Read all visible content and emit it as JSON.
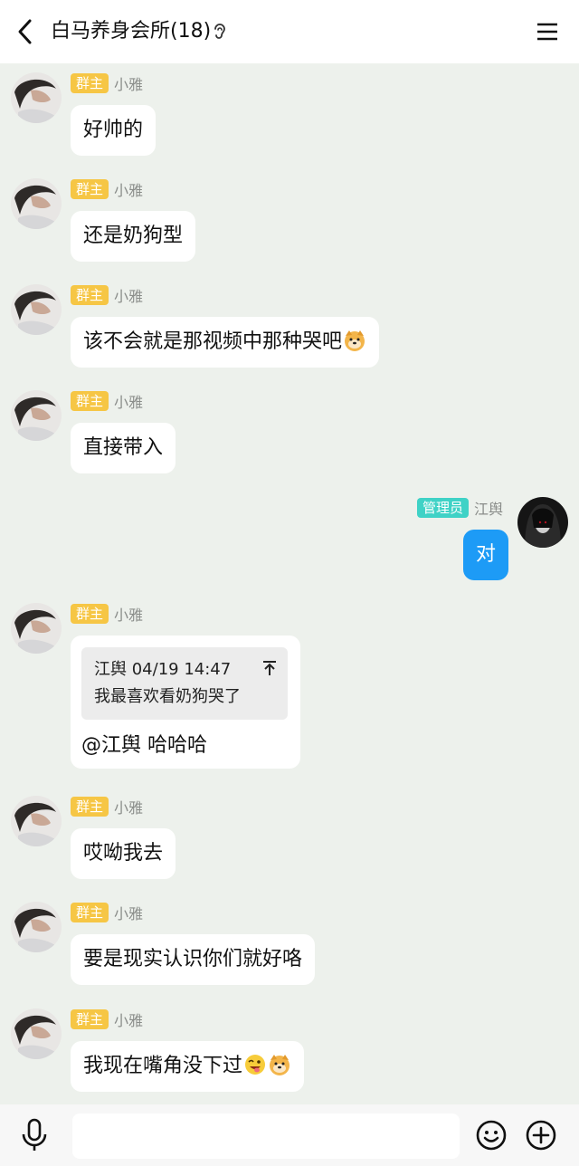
{
  "header": {
    "title": "白马养身会所(18)"
  },
  "messages": [
    {
      "role": "群主",
      "name": "小雅",
      "text": "好帅的"
    },
    {
      "role": "群主",
      "name": "小雅",
      "text": "还是奶狗型"
    },
    {
      "role": "群主",
      "name": "小雅",
      "text": "该不会就是那视频中那种哭吧"
    },
    {
      "role": "群主",
      "name": "小雅",
      "text": "直接带入"
    },
    {
      "role": "管理员",
      "name": "江舆",
      "text": "对"
    },
    {
      "role": "群主",
      "name": "小雅",
      "quote_header": "江舆 04/19 14:47",
      "quote_text": "我最喜欢看奶狗哭了",
      "text": "@江舆 哈哈哈"
    },
    {
      "role": "群主",
      "name": "小雅",
      "text": "哎呦我去"
    },
    {
      "role": "群主",
      "name": "小雅",
      "text": "要是现实认识你们就好咯"
    },
    {
      "role": "群主",
      "name": "小雅",
      "text": "我现在嘴角没下过"
    }
  ],
  "icons": {
    "back": "chevron-left-icon",
    "ear": "ear-icon",
    "menu": "menu-icon",
    "mic": "microphone-icon",
    "emoji": "smiley-icon",
    "plus": "plus-circle-icon"
  },
  "colors": {
    "owner_badge": "#f6c645",
    "admin_badge": "#3fd2c6",
    "self_bubble": "#1d9bf6",
    "background": "#edf1ec"
  }
}
